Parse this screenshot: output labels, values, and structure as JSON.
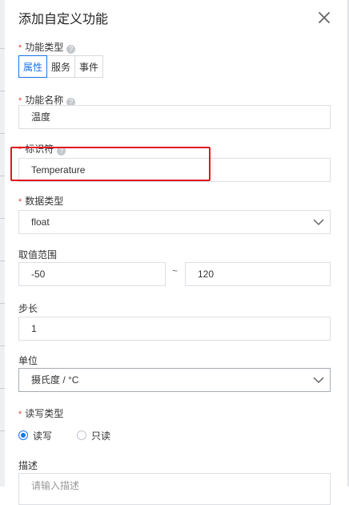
{
  "dialog": {
    "title": "添加自定义功能"
  },
  "form": {
    "type_label": "功能类型",
    "type_options": [
      "属性",
      "服务",
      "事件"
    ],
    "type_selected": "属性",
    "name_label": "功能名称",
    "name_value": "温度",
    "identifier_label": "标识符",
    "identifier_value": "Temperature",
    "data_type_label": "数据类型",
    "data_type_value": "float",
    "range_label": "取值范围",
    "range_min": "-50",
    "range_sep": "~",
    "range_max": "120",
    "step_label": "步长",
    "step_value": "1",
    "unit_label": "单位",
    "unit_value": "摄氏度 / °C",
    "rw_label": "读写类型",
    "rw_options": [
      "读写",
      "只读"
    ],
    "rw_selected": "读写",
    "desc_label": "描述",
    "desc_placeholder": "请输入描述"
  },
  "colors": {
    "accent": "#1a74e8",
    "required_asterisk": "#e5453b",
    "highlight": "#e3161f"
  },
  "icons": {
    "close": "close-icon",
    "help": "question-circle-icon",
    "dropdown": "chevron-down-icon"
  }
}
